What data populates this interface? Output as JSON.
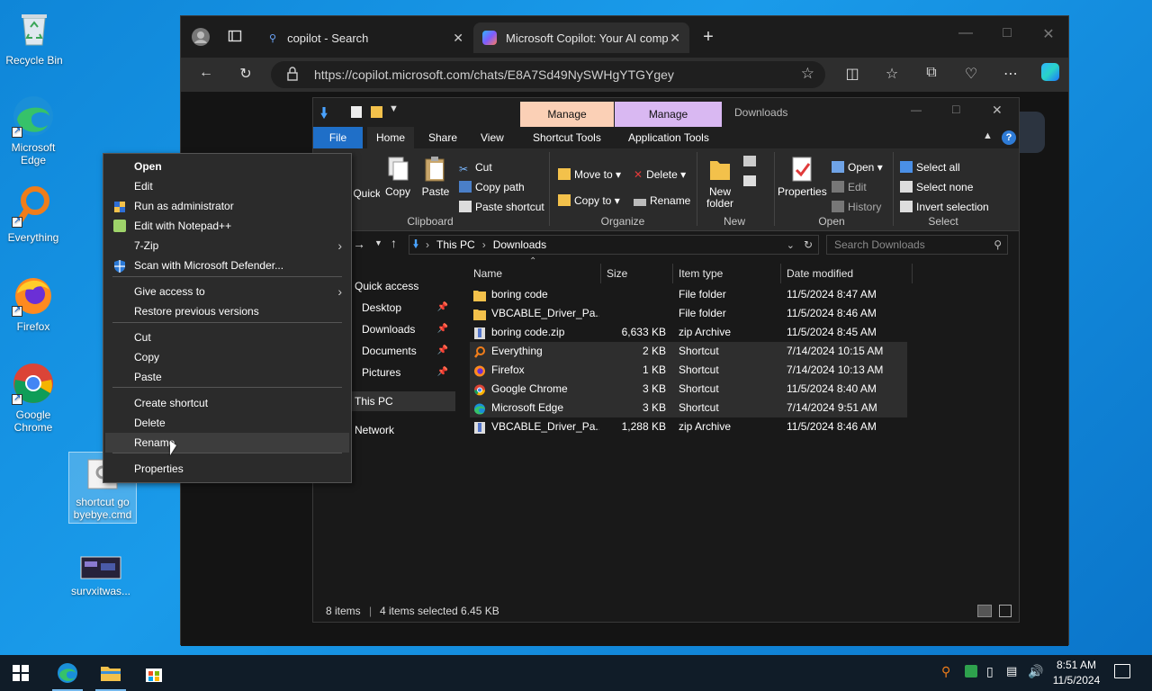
{
  "desktop": {
    "icons": [
      {
        "label": "Recycle Bin",
        "icon": "recycle-bin-icon"
      },
      {
        "label": "Microsoft Edge",
        "icon": "edge-icon"
      },
      {
        "label": "Everything",
        "icon": "everything-icon"
      },
      {
        "label": "Firefox",
        "icon": "firefox-icon"
      },
      {
        "label": "Google Chrome",
        "icon": "chrome-icon"
      },
      {
        "label": "shortcut go byebye.cmd",
        "icon": "cmd-file-icon"
      },
      {
        "label": "survxitwas...",
        "icon": "image-file-icon"
      }
    ]
  },
  "browser": {
    "tabs": [
      {
        "label": "copilot - Search"
      },
      {
        "label": "Microsoft Copilot: Your AI compa..."
      }
    ],
    "url": "https://copilot.microsoft.com/chats/E8A7Sd49NySWHgYTGYgey"
  },
  "explorer": {
    "title": "Downloads",
    "context_tabs": [
      "Manage",
      "Manage"
    ],
    "ribbon_tabs": [
      "File",
      "Home",
      "Share",
      "View",
      "Shortcut Tools",
      "Application Tools"
    ],
    "clipboard": {
      "quick_access": "Quick access",
      "copy": "Copy",
      "paste": "Paste",
      "cut": "Cut",
      "copy_path": "Copy path",
      "paste_shortcut": "Paste shortcut",
      "label": "Clipboard"
    },
    "organize": {
      "move_to": "Move to",
      "copy_to": "Copy to",
      "delete": "Delete",
      "rename": "Rename",
      "label": "Organize"
    },
    "new": {
      "new_folder": "New folder",
      "label": "New"
    },
    "open": {
      "properties": "Properties",
      "open": "Open",
      "edit": "Edit",
      "history": "History",
      "label": "Open"
    },
    "select": {
      "select_all": "Select all",
      "select_none": "Select none",
      "invert": "Invert selection",
      "label": "Select"
    },
    "path": [
      "This PC",
      "Downloads"
    ],
    "search_placeholder": "Search Downloads",
    "nav": {
      "quick_access": "Quick access",
      "desktop": "Desktop",
      "downloads": "Downloads",
      "documents": "Documents",
      "pictures": "Pictures",
      "this_pc": "This PC",
      "network": "Network"
    },
    "columns": [
      "Name",
      "Size",
      "Item type",
      "Date modified"
    ],
    "files": [
      {
        "name": "boring code",
        "size": "",
        "type": "File folder",
        "date": "11/5/2024 8:47 AM",
        "icon": "folder-icon",
        "selected": false
      },
      {
        "name": "VBCABLE_Driver_Pa...",
        "size": "",
        "type": "File folder",
        "date": "11/5/2024 8:46 AM",
        "icon": "folder-icon",
        "selected": false
      },
      {
        "name": "boring code.zip",
        "size": "6,633 KB",
        "type": "zip Archive",
        "date": "11/5/2024 8:45 AM",
        "icon": "zip-icon",
        "selected": false
      },
      {
        "name": "Everything",
        "size": "2 KB",
        "type": "Shortcut",
        "date": "7/14/2024 10:15 AM",
        "icon": "everything-icon",
        "selected": true
      },
      {
        "name": "Firefox",
        "size": "1 KB",
        "type": "Shortcut",
        "date": "7/14/2024 10:13 AM",
        "icon": "firefox-icon",
        "selected": true
      },
      {
        "name": "Google Chrome",
        "size": "3 KB",
        "type": "Shortcut",
        "date": "11/5/2024 8:40 AM",
        "icon": "chrome-icon",
        "selected": true
      },
      {
        "name": "Microsoft Edge",
        "size": "3 KB",
        "type": "Shortcut",
        "date": "7/14/2024 9:51 AM",
        "icon": "edge-icon",
        "selected": true
      },
      {
        "name": "VBCABLE_Driver_Pa...",
        "size": "1,288 KB",
        "type": "zip Archive",
        "date": "11/5/2024 8:46 AM",
        "icon": "zip-icon",
        "selected": false
      }
    ],
    "status": {
      "items": "8 items",
      "selected": "4 items selected 6.45 KB"
    }
  },
  "context_menu": {
    "items": [
      {
        "label": "Open",
        "bold": true
      },
      {
        "label": "Edit"
      },
      {
        "label": "Run as administrator",
        "icon": "shield-icon"
      },
      {
        "label": "Edit with Notepad++",
        "icon": "notepad-plus-icon"
      },
      {
        "label": "7-Zip",
        "submenu": true
      },
      {
        "label": "Scan with Microsoft Defender...",
        "icon": "defender-icon"
      },
      {
        "label": "Give access to",
        "submenu": true
      },
      {
        "label": "Restore previous versions"
      },
      {
        "label": "Cut"
      },
      {
        "label": "Copy"
      },
      {
        "label": "Paste"
      },
      {
        "label": "Create shortcut"
      },
      {
        "label": "Delete"
      },
      {
        "label": "Rename",
        "hover": true
      },
      {
        "label": "Properties"
      }
    ]
  },
  "taskbar": {
    "time": "8:51 AM",
    "date": "11/5/2024"
  },
  "colors": {
    "accent": "#1f6fc8",
    "manage_shortcut": "#fbd0b6",
    "manage_app": "#d9b8f2"
  }
}
